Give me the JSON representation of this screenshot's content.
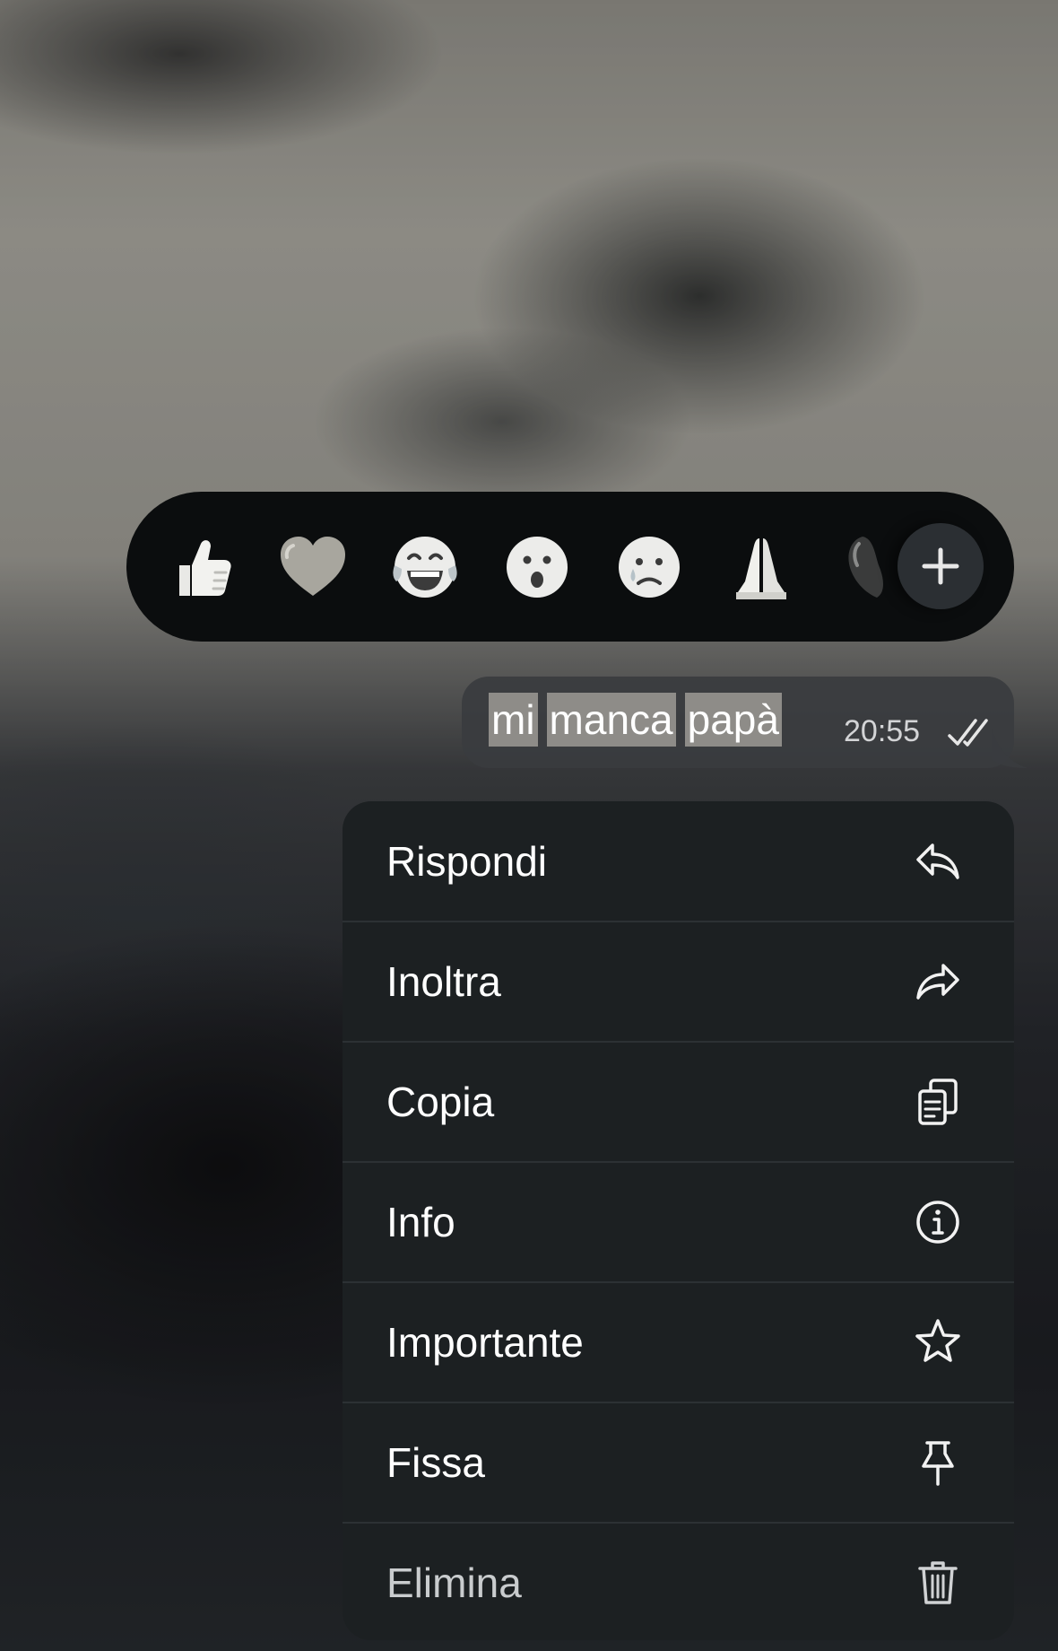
{
  "reactions": {
    "items": [
      {
        "icon": "thumbs-up-emoji"
      },
      {
        "icon": "heart-emoji"
      },
      {
        "icon": "tears-of-joy-emoji"
      },
      {
        "icon": "surprised-emoji"
      },
      {
        "icon": "crying-emoji"
      },
      {
        "icon": "folded-hands-emoji"
      },
      {
        "icon": "more-emoji-partial"
      }
    ],
    "add_icon": "plus-icon"
  },
  "message": {
    "words": [
      "mi",
      "manca",
      "papà"
    ],
    "time": "20:55",
    "status_icon": "double-check-icon"
  },
  "menu": {
    "items": [
      {
        "label": "Rispondi",
        "icon": "reply-icon"
      },
      {
        "label": "Inoltra",
        "icon": "forward-icon"
      },
      {
        "label": "Copia",
        "icon": "copy-icon"
      },
      {
        "label": "Info",
        "icon": "info-icon"
      },
      {
        "label": "Importante",
        "icon": "star-icon"
      },
      {
        "label": "Fissa",
        "icon": "pin-icon"
      },
      {
        "label": "Elimina",
        "icon": "trash-icon"
      }
    ]
  },
  "colors": {
    "menu_background": "#1c2022",
    "reaction_bar": "#0b0d0e",
    "bubble": "#3a3c3f",
    "text": "#ffffff"
  }
}
